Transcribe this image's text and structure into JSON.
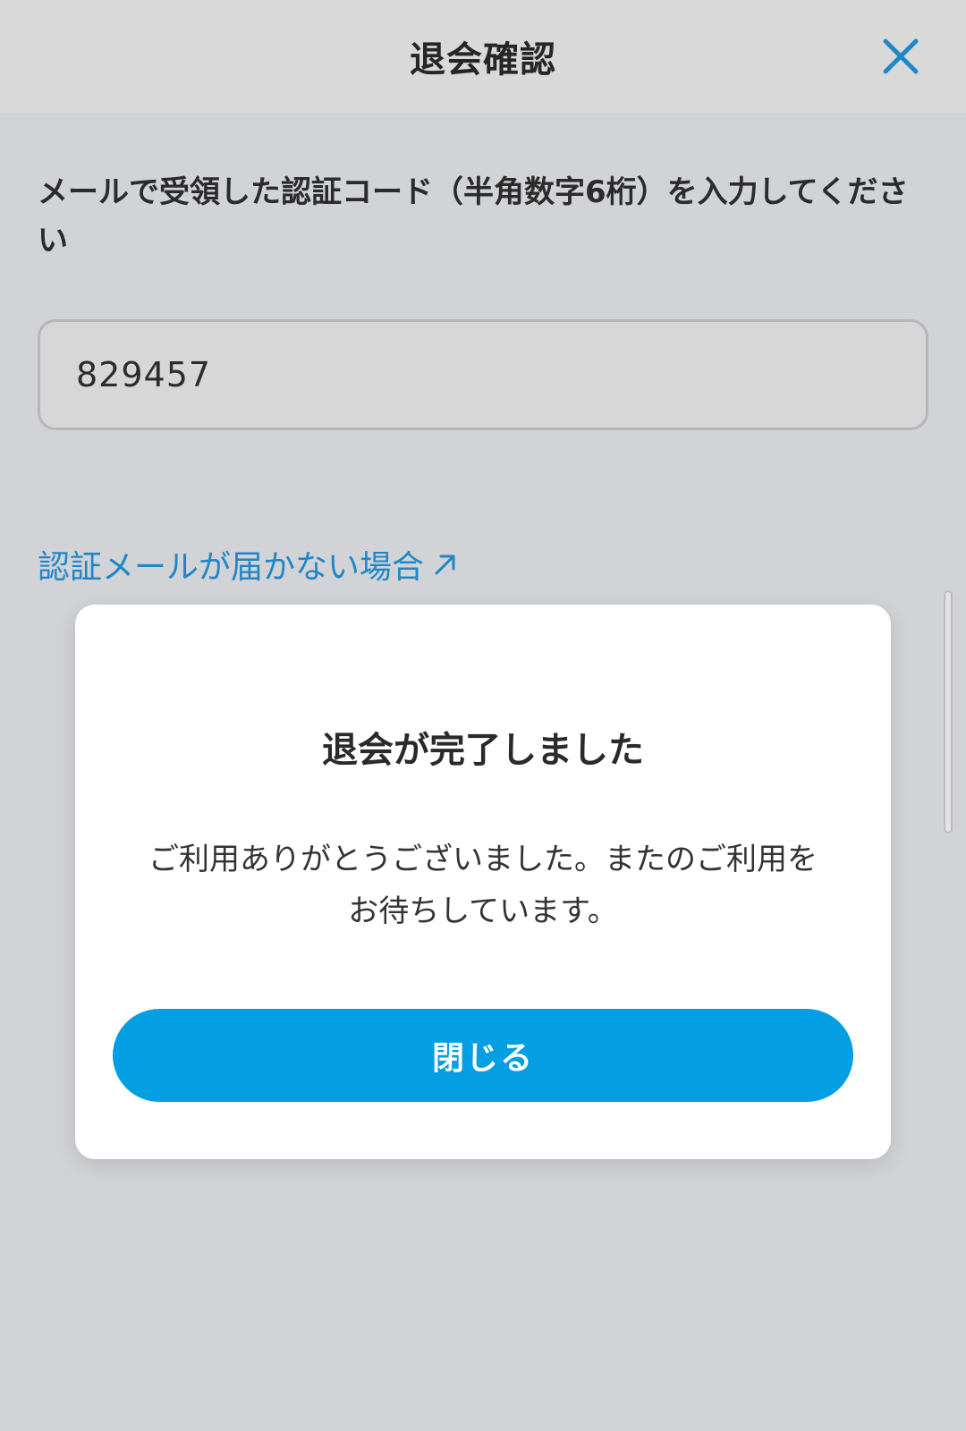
{
  "header": {
    "title": "退会確認",
    "close_icon": "close-icon"
  },
  "form": {
    "instruction": "メールで受領した認証コード（半角数字6桁）を入力してください",
    "code_value": "829457",
    "help_link_label": "認証メールが届かない場合",
    "help_link_icon": "external-arrow-icon"
  },
  "modal": {
    "title": "退会が完了しました",
    "message_line1": "ご利用ありがとうございました。またのご利用を",
    "message_line2": "お待ちしています。",
    "close_button_label": "閉じる"
  },
  "colors": {
    "accent": "#049ee3",
    "link": "#1f87c7",
    "overlay_background": "#d2d3d6"
  }
}
